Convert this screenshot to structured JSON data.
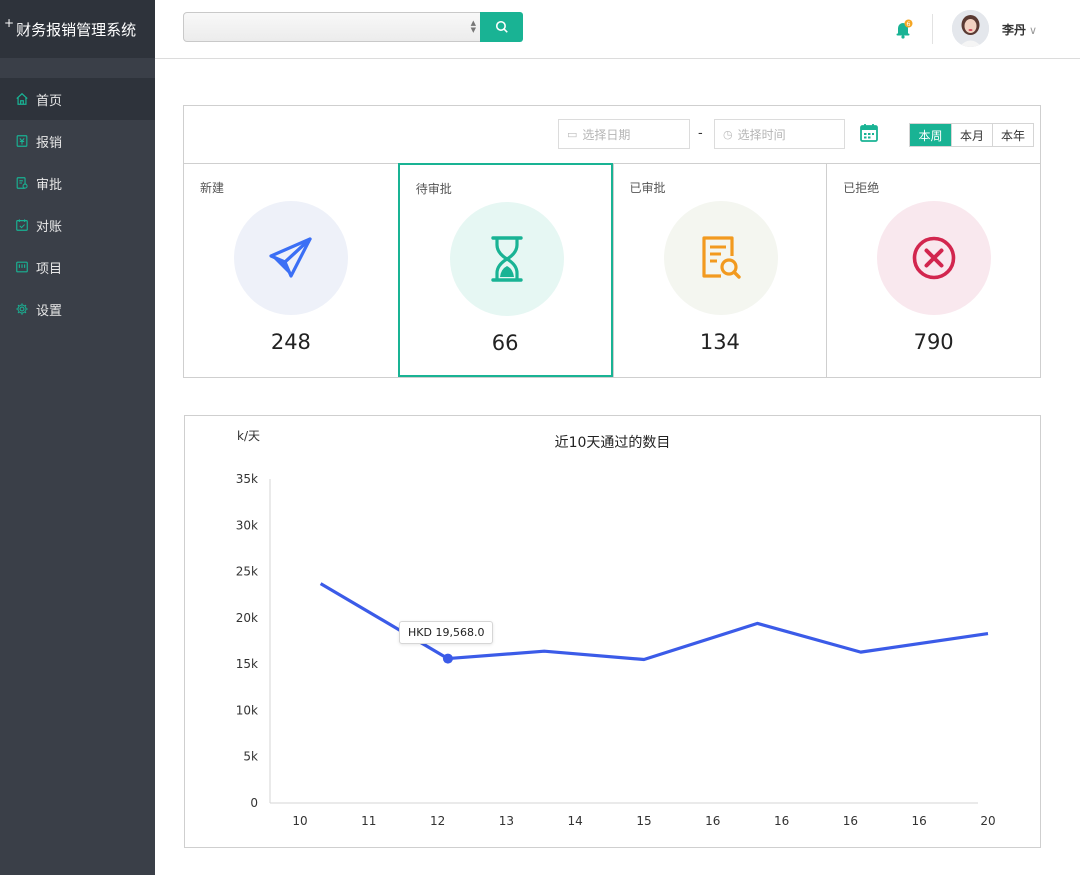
{
  "app": {
    "title": "财务报销管理系统",
    "plus": "+"
  },
  "sidebar": {
    "items": [
      {
        "label": "首页",
        "icon": "home-icon"
      },
      {
        "label": "报销",
        "icon": "receipt-icon"
      },
      {
        "label": "审批",
        "icon": "approval-icon"
      },
      {
        "label": "对账",
        "icon": "calendar-check-icon"
      },
      {
        "label": "项目",
        "icon": "project-icon"
      },
      {
        "label": "设置",
        "icon": "gear-icon"
      }
    ]
  },
  "header": {
    "search_value": "",
    "notification_count": "6",
    "user_name": "李丹",
    "user_chevron": "∨"
  },
  "filter": {
    "date_placeholder": "选择日期",
    "time_placeholder": "选择时间",
    "dash": "-",
    "periods": [
      "本周",
      "本月",
      "本年"
    ],
    "active_period": "本周"
  },
  "stats": [
    {
      "label": "新建",
      "value": "248",
      "icon": "paper-plane-icon",
      "color": "#3b6ff5",
      "bg": "#eef1f9"
    },
    {
      "label": "待审批",
      "value": "66",
      "icon": "hourglass-icon",
      "color": "#19b394",
      "bg": "#e6f7f3"
    },
    {
      "label": "已审批",
      "value": "134",
      "icon": "document-search-icon",
      "color": "#f29a1f",
      "bg": "#f4f6f0"
    },
    {
      "label": "已拒绝",
      "value": "790",
      "icon": "close-circle-icon",
      "color": "#d2264e",
      "bg": "#f9e8ee"
    }
  ],
  "chart_data": {
    "type": "line",
    "title": "近10天通过的数目",
    "ylabel": "k/天",
    "ylim": [
      0,
      35000
    ],
    "yticks": [
      "0",
      "5k",
      "10k",
      "15k",
      "20k",
      "25k",
      "30k",
      "35k"
    ],
    "categories": [
      "10",
      "11",
      "12",
      "13",
      "14",
      "15",
      "16",
      "16",
      "16",
      "16",
      "20"
    ],
    "series": [
      {
        "x": [
          0.3,
          2.15,
          3.55,
          5.0,
          6.65,
          8.15,
          10.0
        ],
        "values": [
          23700,
          15600,
          16400,
          15500,
          19400,
          16300,
          18300
        ],
        "color": "#3b5be8"
      }
    ],
    "tooltip": {
      "text": "HKD 19,568.0"
    }
  }
}
